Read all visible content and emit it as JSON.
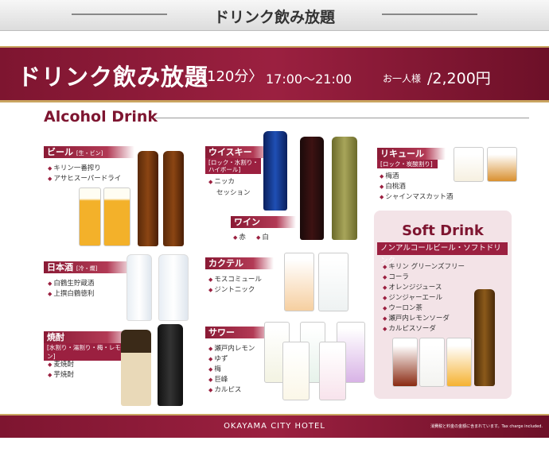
{
  "header": {
    "title": "ドリンク飲み放題"
  },
  "banner": {
    "title": "ドリンク飲み放題",
    "duration": "〈120分〉",
    "time": "17:00〜21:00",
    "price_label": "お一人様",
    "price": "/2,200円"
  },
  "alcohol_section": {
    "title": "Alcohol Drink"
  },
  "categories": {
    "beer": {
      "label": "ビール",
      "note": "[生・ビン]",
      "items": [
        "キリン一番搾り",
        "アサヒスーパードライ"
      ]
    },
    "sake": {
      "label": "日本酒",
      "note": "[冷・燗]",
      "items": [
        "白鶴生貯蔵酒",
        "上撰白鶴徳利"
      ]
    },
    "shochu": {
      "label": "焼酎",
      "note": "[水割り・湯割り・梅・レモン]",
      "items": [
        "麦焼酎",
        "芋焼酎"
      ]
    },
    "whisky": {
      "label": "ウイスキー",
      "note1": "[ロック・水割り・",
      "note2": "ハイボール]",
      "items": [
        "ニッカ"
      ],
      "item2": "セッション"
    },
    "wine": {
      "label": "ワイン",
      "items": [
        "赤",
        "白"
      ]
    },
    "cocktail": {
      "label": "カクテル",
      "items": [
        "モスコミュール",
        "ジントニック"
      ]
    },
    "sour": {
      "label": "サワー",
      "items": [
        "瀬戸内レモン",
        "ゆず",
        "梅",
        "巨峰",
        "カルピス"
      ]
    },
    "liqueur": {
      "label": "リキュール",
      "note": "[ロック・炭酸割り]",
      "items": [
        "梅酒",
        "白桃酒",
        "シャインマスカット酒"
      ]
    }
  },
  "soft_section": {
    "title": "Soft Drink",
    "category": "ノンアルコールビール・ソフトドリンク",
    "items": [
      "キリン グリーンズフリー",
      "コーラ",
      "オレンジジュース",
      "ジンジャーエール",
      "ウーロン茶",
      "瀬戸内レモンソーダ",
      "カルピスソーダ"
    ]
  },
  "footer": {
    "hotel": "OKAYAMA CITY HOTEL",
    "tax_note": "消費税と料金の金額に含まれています。Tax charge included."
  },
  "colors": {
    "brand": "#9b2040",
    "gold": "#c9a561"
  }
}
